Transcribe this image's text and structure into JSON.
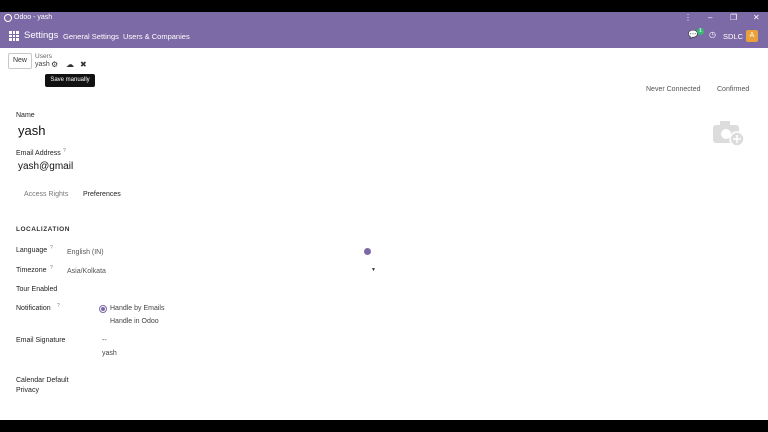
{
  "window": {
    "title": "Odoo - yash"
  },
  "nav": {
    "app_name": "Settings",
    "menu_general": "General Settings",
    "menu_users": "Users & Companies",
    "badge_count": "1",
    "company": "SDLC",
    "avatar_letter": "A",
    "accent_color": "#7b6aa5"
  },
  "controls": {
    "new_label": "New",
    "breadcrumb_parent": "Users",
    "breadcrumb_current": "yash",
    "tooltip": "Save manually"
  },
  "status": {
    "never_connected": "Never Connected",
    "confirmed": "Confirmed"
  },
  "form": {
    "name_label": "Name",
    "name_value": "yash",
    "email_label": "Email Address",
    "email_value": "yash@gmail",
    "tabs": [
      "Access Rights",
      "Preferences"
    ],
    "section": "LOCALIZATION",
    "language_label": "Language",
    "language_value": "English (IN)",
    "timezone_label": "Timezone",
    "timezone_value": "Asia/Kolkata",
    "tour_label": "Tour Enabled",
    "notification_label": "Notification",
    "notification_opt1": "Handle by Emails",
    "notification_opt2": "Handle in Odoo",
    "signature_label": "Email Signature",
    "signature_line1": "--",
    "signature_line2": "yash",
    "calendar_label1": "Calendar Default",
    "calendar_label2": "Privacy"
  },
  "help_mark": "?"
}
